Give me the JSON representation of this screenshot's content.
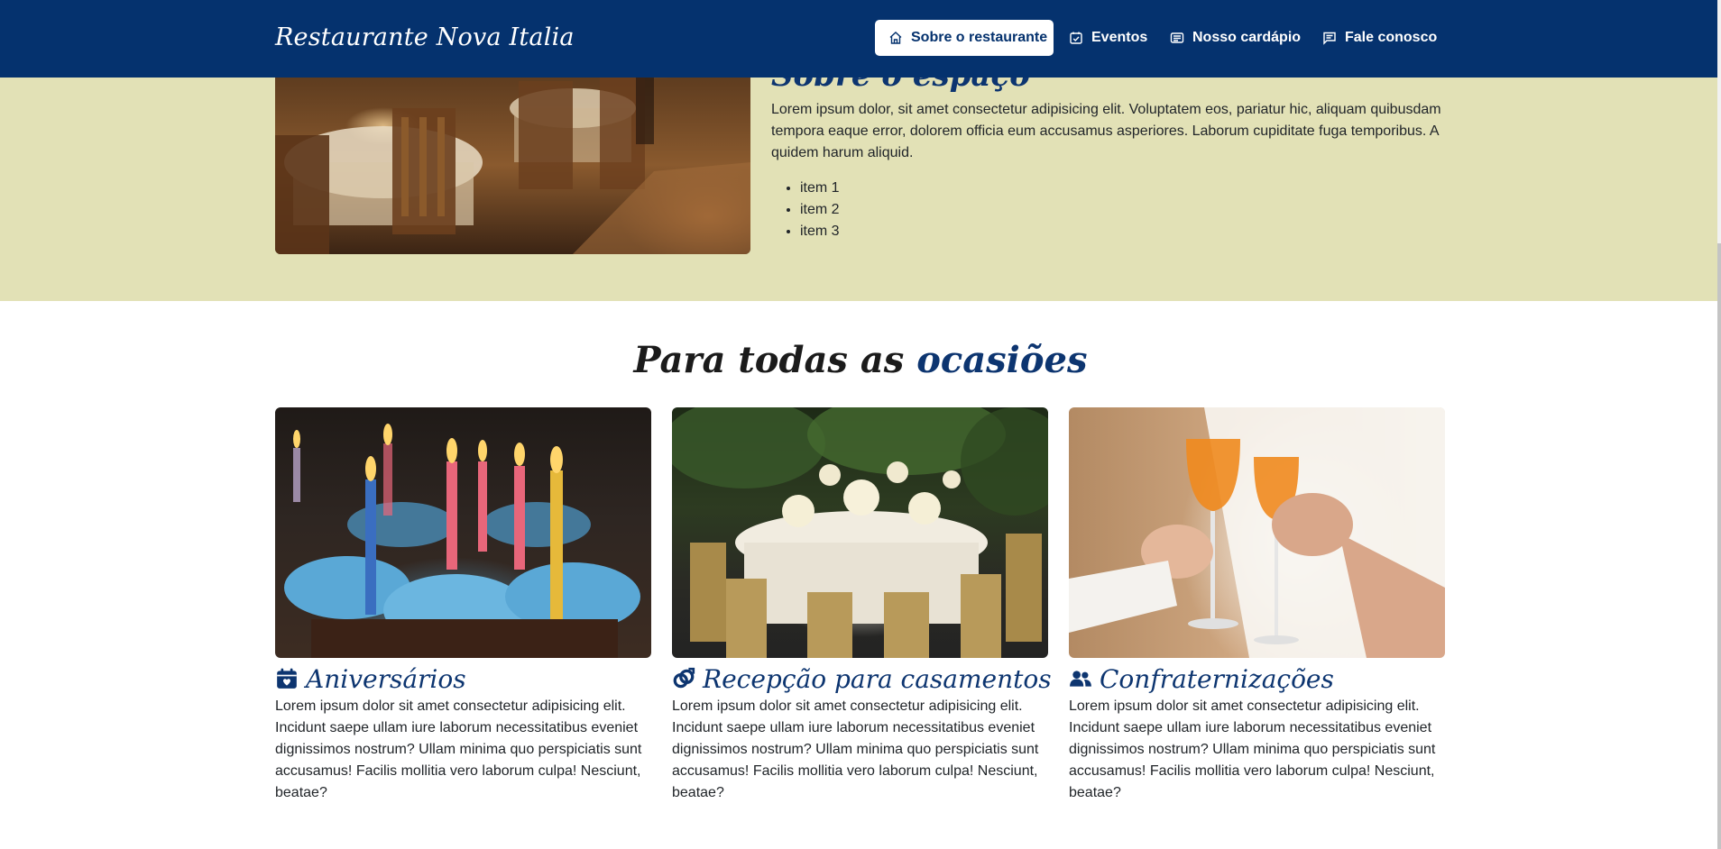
{
  "navbar": {
    "brand": "Restaurante Nova Italia",
    "links": [
      {
        "label": "Sobre o restaurante",
        "icon": "home-icon",
        "active": true
      },
      {
        "label": "Eventos",
        "icon": "calendar-check-icon",
        "active": false
      },
      {
        "label": "Nosso cardápio",
        "icon": "menu-card-icon",
        "active": false
      },
      {
        "label": "Fale conosco",
        "icon": "chat-icon",
        "active": false
      }
    ]
  },
  "about": {
    "title_part1": "Sobre o",
    "title_part2": "espaço",
    "body": "Lorem ipsum dolor, sit amet consectetur adipisicing elit. Voluptatem eos, pariatur hic, aliquam quibusdam tempora eaque error, dolorem officia eum accusamus asperiores. Laborum cupiditate fuga temporibus. A quidem harum aliquid.",
    "items": [
      "item 1",
      "item 2",
      "item 3"
    ]
  },
  "occasions": {
    "title_part1": "Para todas as",
    "title_part2": "ocasiões",
    "cards": [
      {
        "title": "Aniversários",
        "icon": "calendar-heart-icon",
        "text": "Lorem ipsum dolor sit amet consectetur adipisicing elit. Incidunt saepe ullam iure laborum necessitatibus eveniet dignissimos nostrum? Ullam minima quo perspiciatis sunt accusamus! Facilis mollitia vero laborum culpa! Nesciunt, beatae?"
      },
      {
        "title": "Recepção para casamentos",
        "icon": "wedding-rings-icon",
        "text": "Lorem ipsum dolor sit amet consectetur adipisicing elit. Incidunt saepe ullam iure laborum necessitatibus eveniet dignissimos nostrum? Ullam minima quo perspiciatis sunt accusamus! Facilis mollitia vero laborum culpa! Nesciunt, beatae?"
      },
      {
        "title": "Confraternizações",
        "icon": "people-icon",
        "text": "Lorem ipsum dolor sit amet consectetur adipisicing elit. Incidunt saepe ullam iure laborum necessitatibus eveniet dignissimos nostrum? Ullam minima quo perspiciatis sunt accusamus! Facilis mollitia vero laborum culpa! Nesciunt, beatae?"
      }
    ]
  },
  "colors": {
    "navbar_bg": "#05326e",
    "about_bg": "#e2e1b6",
    "accent": "#0d3570"
  }
}
